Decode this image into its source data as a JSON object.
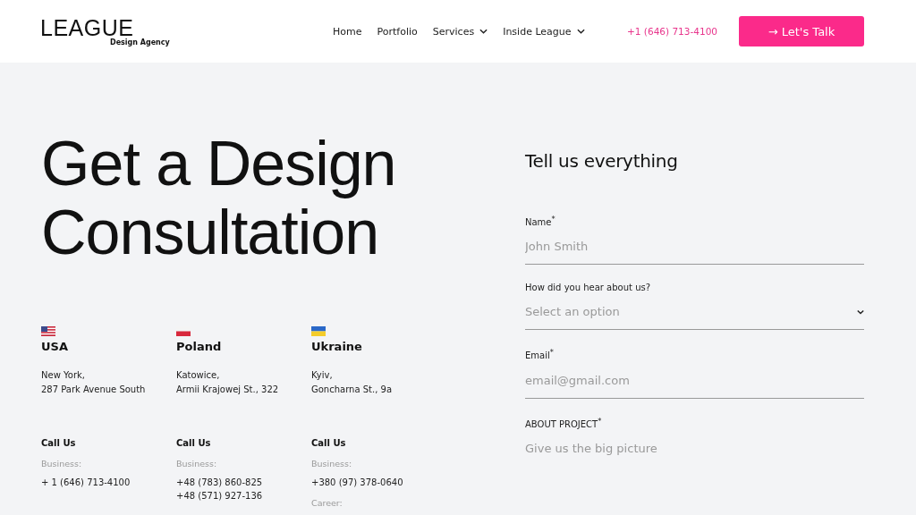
{
  "header": {
    "logo": {
      "name": "LEAGUE",
      "tagline": "Design Agency"
    },
    "nav": [
      {
        "label": "Home",
        "has_menu": false
      },
      {
        "label": "Portfolio",
        "has_menu": false
      },
      {
        "label": "Services",
        "has_menu": true
      },
      {
        "label": "Inside League",
        "has_menu": true
      }
    ],
    "phone": "+1 (646) 713-4100",
    "cta": {
      "icon": "→",
      "label": "Let's Talk"
    }
  },
  "headline": "Get a Design Consultation",
  "offices": [
    {
      "kind": "us",
      "country": "USA",
      "address": [
        "New York,",
        "287 Park Avenue South"
      ],
      "call_title": "Call Us",
      "groups": [
        {
          "label": "Business:",
          "phones": [
            "+ 1 (646) 713-4100"
          ]
        }
      ]
    },
    {
      "kind": "pl",
      "country": "Poland",
      "address": [
        "Katowice,",
        "Armii Krajowej St., 322"
      ],
      "call_title": "Call Us",
      "groups": [
        {
          "label": "Business:",
          "phones": [
            "+48 (783) 860-825",
            "+48 (571) 927-136"
          ]
        }
      ]
    },
    {
      "kind": "ua",
      "country": "Ukraine",
      "address": [
        "Kyiv,",
        "Goncharna St., 9a"
      ],
      "call_title": "Call Us",
      "groups": [
        {
          "label": "Business:",
          "phones": [
            "+380 (97) 378-0640"
          ]
        },
        {
          "label": "Career:"
        }
      ]
    }
  ],
  "form": {
    "title": "Tell us everything",
    "fields": [
      {
        "kind": "input",
        "label": "Name$^{*}$",
        "placeholder": "John Smith"
      },
      {
        "kind": "select",
        "label": "How did you hear about us?",
        "placeholder": "Select an option"
      },
      {
        "kind": "input",
        "label": "Email$^{*}$",
        "placeholder": "email@gmail.com"
      },
      {
        "kind": "textarea",
        "label": "ABOUT PROJECT$^{*}$",
        "placeholder": "Give us the big picture"
      }
    ]
  }
}
